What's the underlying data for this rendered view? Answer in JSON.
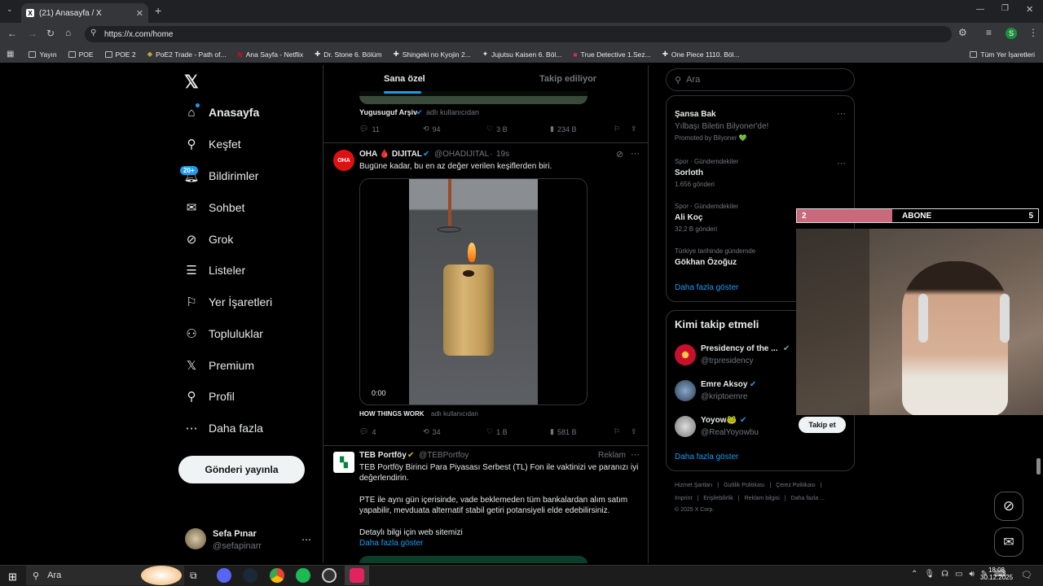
{
  "browser": {
    "tab_title": "(21) Anasayfa / X",
    "url": "https://x.com/home",
    "bookmarks": [
      "Yayın",
      "POE",
      "POE 2",
      "PoE2 Trade - Path of...",
      "Ana Sayfa - Netflix",
      "Dr. Stone 6. Bölüm",
      "Shingeki no Kyojin 2...",
      "Jujutsu Kaisen 6. Böl...",
      "True Detective 1.Sez...",
      "One Piece 1110. Böl..."
    ],
    "all_bookmarks": "Tüm Yer İşaretleri",
    "profile_initial": "S"
  },
  "nav": {
    "items": [
      "Anasayfa",
      "Keşfet",
      "Bildirimler",
      "Sohbet",
      "Grok",
      "Listeler",
      "Yer İşaretleri",
      "Topluluklar",
      "Premium",
      "Profil",
      "Daha fazla"
    ],
    "notif_badge": "20+",
    "post_button": "Gönderi yayınla",
    "user": {
      "name": "Sefa Pınar",
      "handle": "@sefapinarr"
    }
  },
  "tabs": {
    "for_you": "Sana özel",
    "following": "Takip ediliyor"
  },
  "tweets": [
    {
      "context": "Yugusuguf Arşiv",
      "context_suffix": "adlı kullanıcıdan",
      "replies": "11",
      "retweets": "94",
      "likes": "3 B",
      "views": "234 B"
    },
    {
      "name": "OHA 🩸 DIJITAL",
      "handle": "@OHADIJITAL",
      "time": "19s",
      "text": "Bugüne kadar, bu en az değer verilen keşiflerden biri.",
      "video_time": "0:00",
      "context": "HOW THINGS WORK",
      "context_suffix": "adlı kullanıcıdan",
      "replies": "4",
      "retweets": "34",
      "likes": "1 B",
      "views": "581 B",
      "avatar_text": "OHA"
    },
    {
      "name": "TEB Portföy",
      "handle": "@TEBPortfoy",
      "ad_label": "Reklam",
      "line1": "TEB Portföy Birinci Para Piyasası Serbest (TL) Fon ile vaktinizi ve paranızı iyi",
      "line2": "değerlendirin.",
      "line3": "PTE ile aynı gün içerisinde, vade beklemeden tüm bankalardan alım satım",
      "line4": "yapabilir, mevduata alternatif stabil getiri potansiyeli elde edebilirsiniz.",
      "line5": "Detaylı bilgi için web sitemizi",
      "link": "Daha fazla göster"
    }
  ],
  "search_placeholder": "Ara",
  "trends": {
    "promo": {
      "title": "Şansa Bak",
      "sub": "Yılbaşı Biletin Bilyoner'de!",
      "promoted": "Promoted by Bilyoner 💚"
    },
    "items": [
      {
        "cat": "Spor · Gündemdekiler",
        "name": "Sorloth",
        "count": "1.656 gönderi"
      },
      {
        "cat": "Spor · Gündemdekiler",
        "name": "Ali Koç",
        "count": "32,2 B gönderi"
      },
      {
        "cat": "Türkiye tarihinde gündemde",
        "name": "Gökhan Özoğuz",
        "count": ""
      }
    ],
    "more": "Daha fazla göster"
  },
  "who_to_follow": {
    "title": "Kimi takip etmeli",
    "users": [
      {
        "name": "Presidency of the ...",
        "handle": "@trpresidency"
      },
      {
        "name": "Emre Aksoy",
        "handle": "@kriptoemre"
      },
      {
        "name": "Yoyow🐸",
        "handle": "@RealYoyowbu"
      }
    ],
    "follow": "Takip et",
    "more": "Daha fazla göster"
  },
  "footer": {
    "row1": [
      "Hizmet Şartları",
      "Gizlilik Politikası",
      "Çerez Politikası"
    ],
    "row2": [
      "Imprint",
      "Erişilebilirlik",
      "Reklam bilgisi",
      "Daha fazla ..."
    ],
    "copy": "© 2025 X Corp."
  },
  "overlay": {
    "left": "2",
    "label": "ABONE",
    "right": "5"
  },
  "taskbar": {
    "search": "Ara",
    "time": "18:08",
    "date": "30.12.2025"
  }
}
